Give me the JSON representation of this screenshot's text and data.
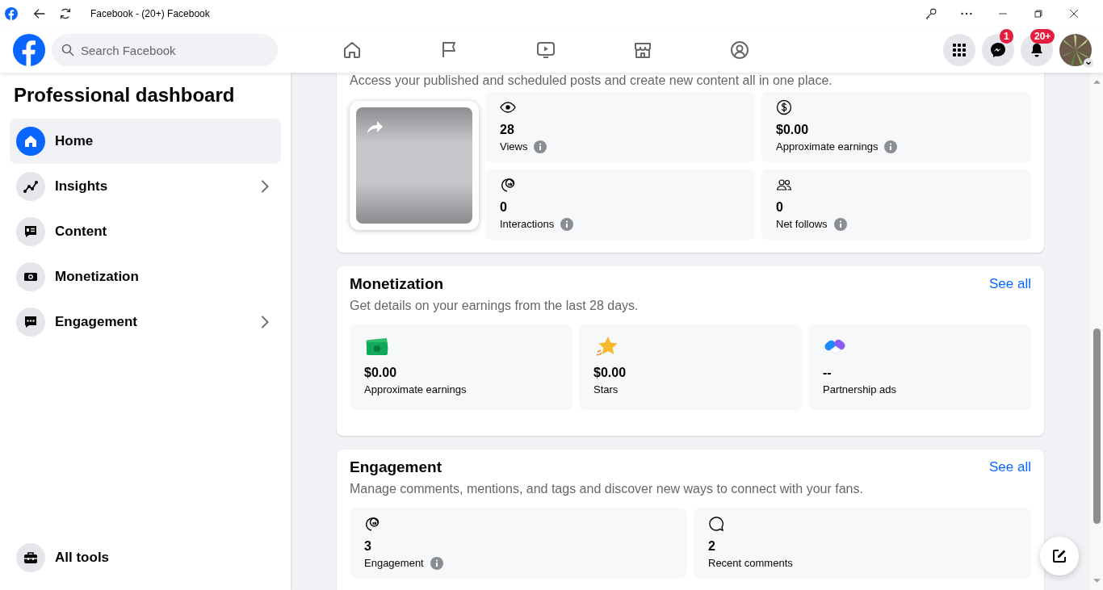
{
  "browser": {
    "title": "Facebook - (20+) Facebook"
  },
  "header": {
    "search": {
      "placeholder": "Search Facebook"
    },
    "messenger_badge": "1",
    "notifications_badge": "20+"
  },
  "sidebar": {
    "title": "Professional dashboard",
    "items": [
      {
        "label": "Home",
        "selected": true,
        "kind": "link"
      },
      {
        "label": "Insights",
        "selected": false,
        "kind": "group"
      },
      {
        "label": "Content",
        "selected": false,
        "kind": "link"
      },
      {
        "label": "Monetization",
        "selected": false,
        "kind": "link"
      },
      {
        "label": "Engagement",
        "selected": false,
        "kind": "group"
      }
    ],
    "footer_item": {
      "label": "All tools"
    }
  },
  "sections": [
    {
      "subtitle": "Access your published and scheduled posts and create new content all in one place.",
      "preview": {
        "kind": "picture"
      },
      "tiles": [
        {
          "value": "28",
          "label": "Views",
          "info": true
        },
        {
          "value": "$0.00",
          "label": "Approximate earnings",
          "info": true
        },
        {
          "value": "0",
          "label": "Interactions",
          "info": true
        },
        {
          "value": "0",
          "label": "Net follows",
          "info": true
        }
      ]
    },
    {
      "title": "Monetization",
      "link": "See all",
      "subtitle": "Get details on your earnings from the last 28 days.",
      "tiles": [
        {
          "value": "$0.00",
          "label": "Approximate earnings",
          "info": false
        },
        {
          "value": "$0.00",
          "label": "Stars",
          "info": false
        },
        {
          "value": "--",
          "label": "Partnership ads",
          "info": false
        }
      ]
    },
    {
      "title": "Engagement",
      "link": "See all",
      "subtitle": "Manage comments, mentions, and tags and discover new ways to connect with your fans.",
      "tiles": [
        {
          "value": "3",
          "label": "Engagement",
          "info": true
        },
        {
          "value": "2",
          "label": "Recent comments",
          "info": false
        }
      ]
    }
  ]
}
